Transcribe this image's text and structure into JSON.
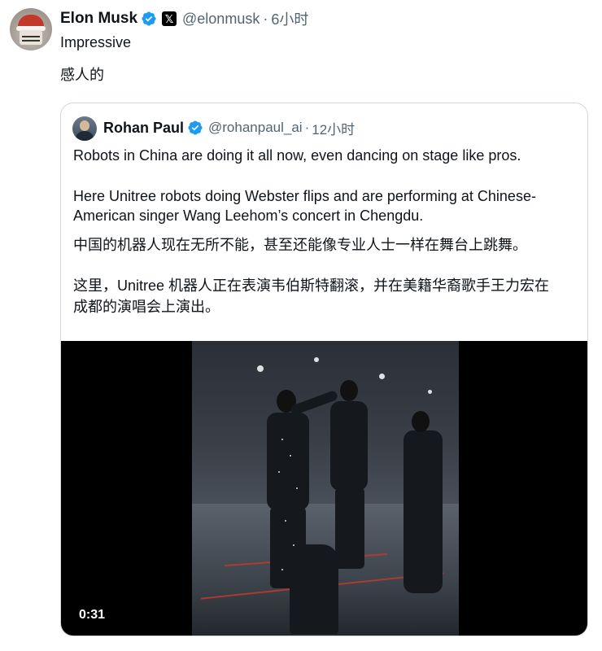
{
  "tweet": {
    "author_name": "Elon Musk",
    "author_handle": "@elonmusk",
    "separator": "·",
    "time": "6小时",
    "badge_x": "𝕏",
    "lines": [
      "Impressive",
      "感人的"
    ]
  },
  "quote": {
    "author_name": "Rohan Paul",
    "author_handle": "@rohanpaul_ai",
    "separator": "·",
    "time": "12小时",
    "lines": [
      "Robots in China are doing it all now, even dancing on stage like pros.",
      "Here Unitree robots doing Webster flips and are performing at Chinese-",
      "American singer Wang Leehom’s concert in Chengdu.",
      "中国的机器人现在无所不能，甚至还能像专业人士一样在舞台上跳舞。",
      "这里，Unitree 机器人正在表演韦伯斯特翻滚，并在美籍华裔歌手王力宏在",
      "成都的演唱会上演出。"
    ]
  },
  "video": {
    "duration": "0:31"
  },
  "colors": {
    "text_primary": "#0f1419",
    "text_secondary": "#536471",
    "verified_blue": "#1d9bf0",
    "card_border": "#cfd9de"
  },
  "icons": [
    "verified-badge-icon",
    "x-affiliate-badge-icon"
  ]
}
